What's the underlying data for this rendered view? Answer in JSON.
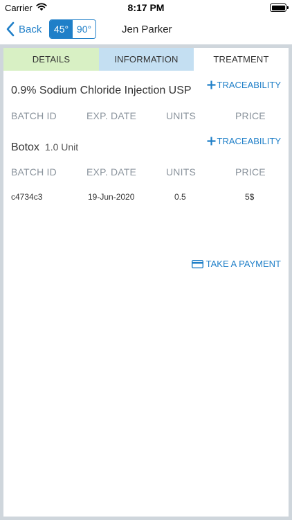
{
  "status_bar": {
    "carrier": "Carrier",
    "time": "8:17 PM"
  },
  "nav": {
    "back_label": "Back",
    "angles": [
      {
        "label": "45°",
        "selected": true
      },
      {
        "label": "90°",
        "selected": false
      }
    ],
    "title": "Jen Parker"
  },
  "tabs": [
    {
      "label": "DETAILS",
      "color": "#d8f0c4"
    },
    {
      "label": "INFORMATION",
      "color": "#c4dff2"
    },
    {
      "label": "TREATMENT",
      "color": "#ffffff",
      "selected": true
    }
  ],
  "treatment": {
    "columns": [
      "BATCH ID",
      "EXP. DATE",
      "UNITS",
      "PRICE"
    ],
    "products": [
      {
        "name": "0.9% Sodium Chloride Injection USP",
        "qty": "",
        "trace_label": "TRACEABILITY",
        "rows": []
      },
      {
        "name": "Botox",
        "qty": "1.0 Unit",
        "trace_label": "TRACEABILITY",
        "rows": [
          {
            "batch_id": "c4734c3",
            "exp_date": "19-Jun-2020",
            "units": "0.5",
            "price": "5$"
          }
        ]
      }
    ],
    "payment_label": "TAKE A PAYMENT"
  },
  "colors": {
    "accent": "#1f7fc8",
    "frame": "#cfd6dc",
    "header_text": "#8a939c"
  }
}
